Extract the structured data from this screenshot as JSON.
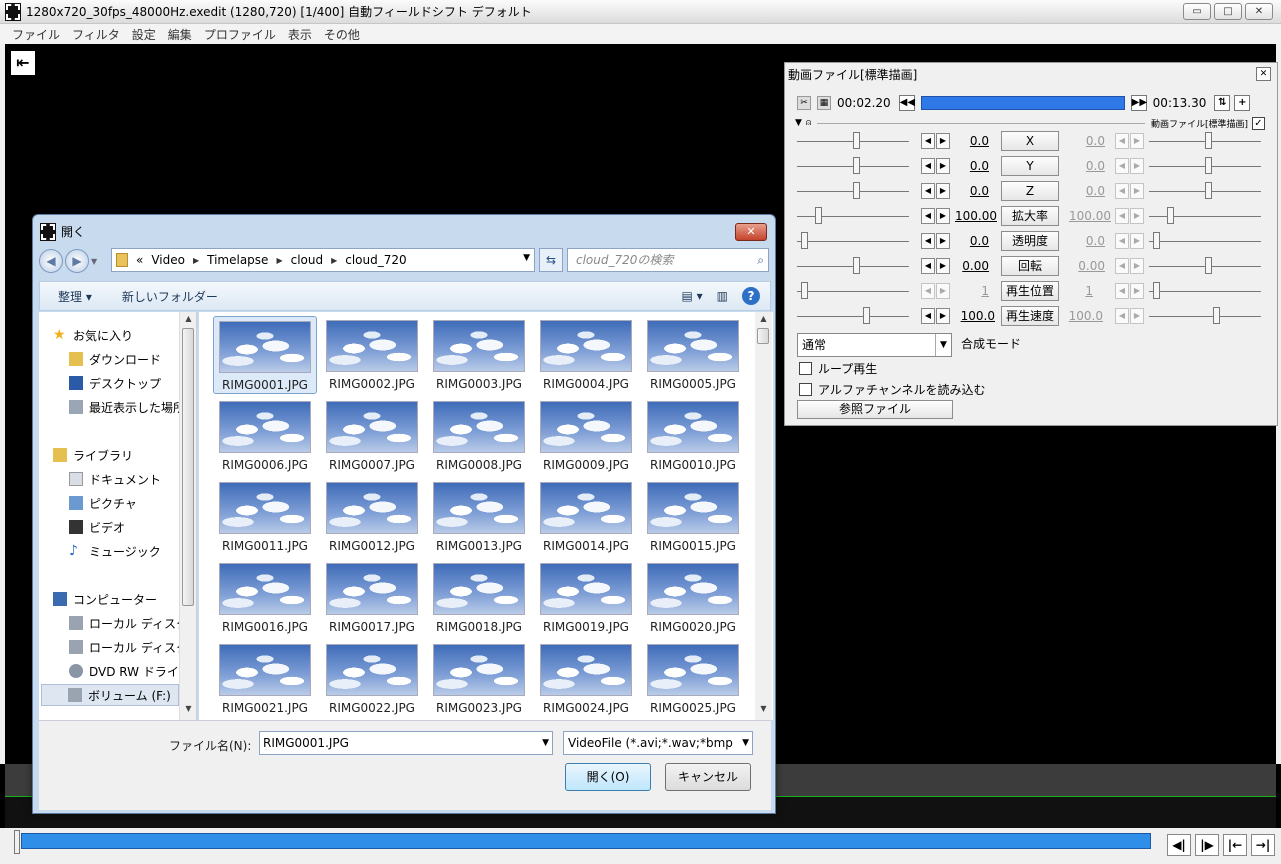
{
  "window": {
    "title": "1280x720_30fps_48000Hz.exedit (1280,720)  [1/400]  自動フィールドシフト  デフォルト",
    "buttons": [
      "▭",
      "□",
      "✕"
    ]
  },
  "menu": [
    "ファイル",
    "フィルタ",
    "設定",
    "編集",
    "プロファイル",
    "表示",
    "その他"
  ],
  "panel": {
    "title": "動画ファイル[標準描画]",
    "close": "✕",
    "time_start": "00:02.20",
    "time_end": "00:13.30",
    "object_label": "動画ファイル[標準描画]",
    "object_checked": "✓",
    "params": [
      {
        "name": "X",
        "left": "0.0",
        "right": "0.0"
      },
      {
        "name": "Y",
        "left": "0.0",
        "right": "0.0"
      },
      {
        "name": "Z",
        "left": "0.0",
        "right": "0.0"
      },
      {
        "name": "拡大率",
        "left": "100.00",
        "right": "100.00"
      },
      {
        "name": "透明度",
        "left": "0.0",
        "right": "0.0"
      },
      {
        "name": "回転",
        "left": "0.00",
        "right": "0.00"
      },
      {
        "name": "再生位置",
        "left": "1",
        "right": "1"
      },
      {
        "name": "再生速度",
        "left": "100.0",
        "right": "100.0"
      }
    ],
    "blend_mode_value": "通常",
    "blend_mode_label": "合成モード",
    "loop_label": "ループ再生",
    "alpha_label": "アルファチャンネルを読み込む",
    "ref_button": "参照ファイル"
  },
  "dialog": {
    "title": "開く",
    "close": "✕",
    "breadcrumb": [
      "«",
      "Video",
      "Timelapse",
      "cloud",
      "cloud_720"
    ],
    "search_placeholder": "cloud_720の検索",
    "toolbar": {
      "organize": "整理 ▾",
      "new_folder": "新しいフォルダー"
    },
    "nav": [
      {
        "label": "お気に入り",
        "icon": "star-icon",
        "color": "#f3b019"
      },
      {
        "label": "ダウンロード",
        "icon": "download-folder-icon",
        "color": "#e3c050"
      },
      {
        "label": "デスクトップ",
        "icon": "desktop-icon",
        "color": "#2a5aa8"
      },
      {
        "label": "最近表示した場所",
        "icon": "recent-places-icon",
        "color": "#9aa6b6"
      },
      {
        "label": "ライブラリ",
        "icon": "library-icon",
        "color": "#e3c050"
      },
      {
        "label": "ドキュメント",
        "icon": "documents-icon",
        "color": "#d8dde6"
      },
      {
        "label": "ピクチャ",
        "icon": "pictures-icon",
        "color": "#6a9ad0"
      },
      {
        "label": "ビデオ",
        "icon": "videos-icon",
        "color": "#333"
      },
      {
        "label": "ミュージック",
        "icon": "music-icon",
        "color": "#2a6ac4"
      },
      {
        "label": "コンピューター",
        "icon": "computer-icon",
        "color": "#3a6ab0"
      },
      {
        "label": "ローカル ディスク (C:)",
        "icon": "local-disk-icon",
        "color": "#9aa4b0"
      },
      {
        "label": "ローカル ディスク (D:)",
        "icon": "local-disk-icon",
        "color": "#9aa4b0"
      },
      {
        "label": "DVD RW ドライブ",
        "icon": "dvd-drive-icon",
        "color": "#8a96a6"
      },
      {
        "label": "ボリューム (F:)",
        "icon": "volume-icon",
        "color": "#9aa4b0"
      }
    ],
    "files": [
      "RIMG0001.JPG",
      "RIMG0002.JPG",
      "RIMG0003.JPG",
      "RIMG0004.JPG",
      "RIMG0005.JPG",
      "RIMG0006.JPG",
      "RIMG0007.JPG",
      "RIMG0008.JPG",
      "RIMG0009.JPG",
      "RIMG0010.JPG",
      "RIMG0011.JPG",
      "RIMG0012.JPG",
      "RIMG0013.JPG",
      "RIMG0014.JPG",
      "RIMG0015.JPG",
      "RIMG0016.JPG",
      "RIMG0017.JPG",
      "RIMG0018.JPG",
      "RIMG0019.JPG",
      "RIMG0020.JPG",
      "RIMG0021.JPG",
      "RIMG0022.JPG",
      "RIMG0023.JPG",
      "RIMG0024.JPG",
      "RIMG0025.JPG"
    ],
    "filename_label": "ファイル名(N):",
    "filename_value": "RIMG0001.JPG",
    "filter_value": "VideoFile (*.avi;*.wav;*bmp",
    "open_button": "開く(O)",
    "cancel_button": "キャンセル"
  }
}
